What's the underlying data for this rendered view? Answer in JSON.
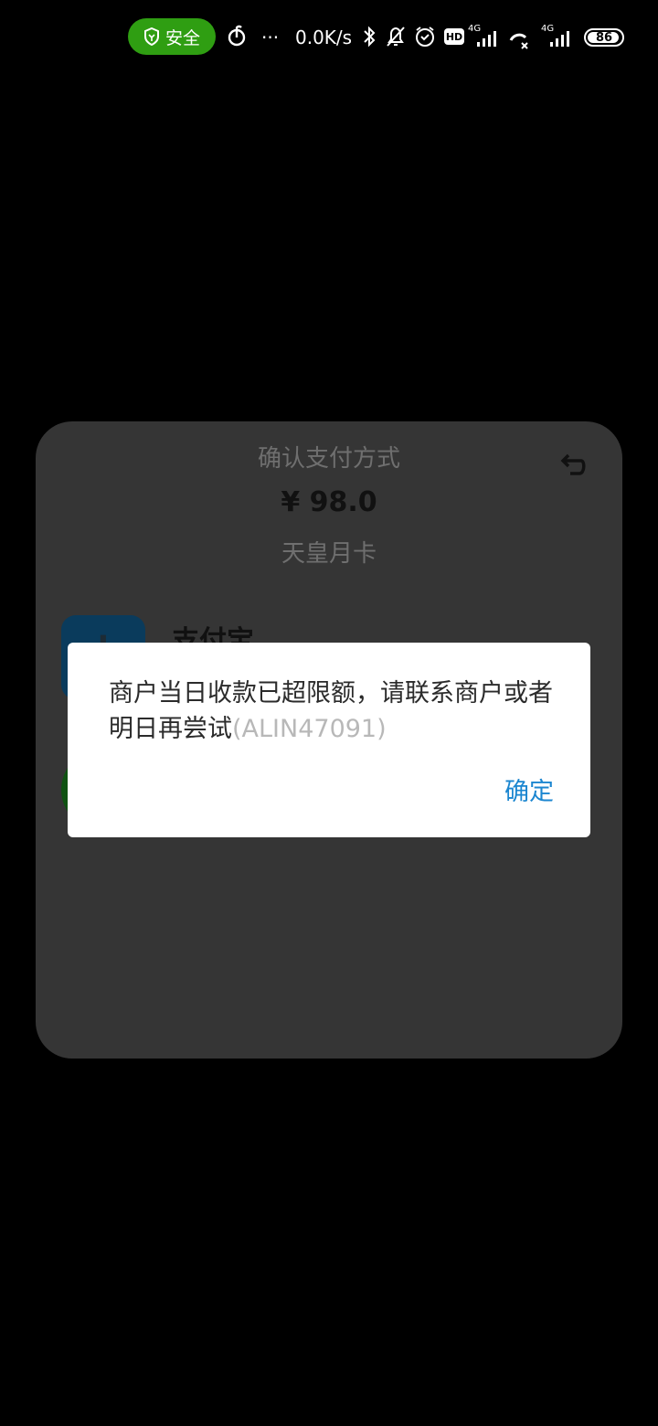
{
  "status_bar": {
    "security_label": "安全",
    "net_speed": "0.0K/s",
    "more_dots": "···",
    "network_1": "4G",
    "network_2": "4G",
    "hd_label": "HD",
    "battery_level": "86",
    "icons": [
      "shield-icon",
      "netease-music-icon",
      "bluetooth-icon",
      "bell-off-icon",
      "alarm-icon",
      "hd-icon",
      "signal-icon",
      "missed-call-icon",
      "signal-icon",
      "battery-icon"
    ]
  },
  "payment_sheet": {
    "title": "确认支付方式",
    "amount": "¥ 98.0",
    "product": "天皇月卡",
    "methods": [
      {
        "name": "支付宝",
        "icon": "alipay-icon"
      },
      {
        "name": "",
        "icon": "wechat-pay-icon"
      }
    ],
    "back_icon": "return-icon"
  },
  "dialog": {
    "message": "商户当日收款已超限额，请联系商户或者明日再尝试",
    "error_code": "(ALIN47091)",
    "confirm_label": "确定"
  },
  "colors": {
    "background": "#000000",
    "safe_pill": "#2f9e12",
    "sheet": "#353535",
    "dialog_bg": "#ffffff",
    "confirm": "#1b86d0",
    "error_code": "#b8b8b8"
  }
}
